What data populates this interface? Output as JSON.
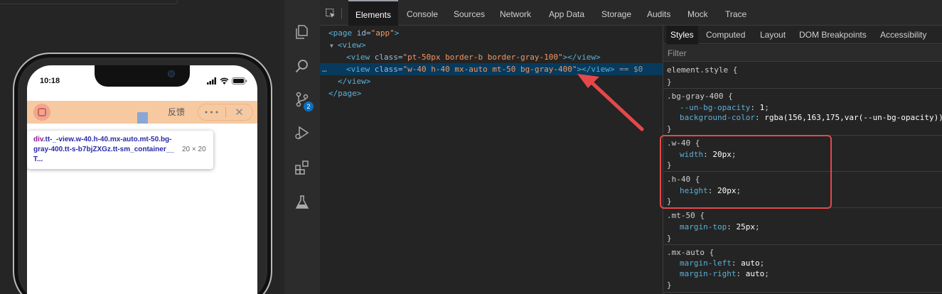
{
  "simulator": {
    "status_time": "10:18",
    "feedback_label": "反馈",
    "more_label": "•••",
    "close_label": "✕",
    "tooltip": {
      "tag": "div",
      "classes": ".tt-_-view.w-40.h-40.mx-auto.mt-50.bg-gray-400.tt-s-b7bjZXGz.tt-sm_container__T...",
      "size": "20 × 20"
    },
    "colors": {
      "navbar": "#f7c9a0",
      "element_highlight": "#8aa7d6"
    }
  },
  "activity_bar": {
    "icons": [
      "files-icon",
      "search-icon",
      "source-control-icon",
      "run-debug-icon",
      "extensions-icon",
      "test-flask-icon"
    ],
    "scm_badge": "2"
  },
  "devtools": {
    "tabs": [
      "Elements",
      "Console",
      "Sources",
      "Network",
      "App Data",
      "Storage",
      "Audits",
      "Mock",
      "Trace"
    ],
    "active_tab": "Elements",
    "dom": {
      "line1": {
        "open": "<page",
        "attr": " id=",
        "val": "\"app\"",
        "close": ">"
      },
      "line2": {
        "text": "<view>"
      },
      "line3": {
        "open": "<view",
        "attr": " class=",
        "val": "\"pt-50px border-b border-gray-100\"",
        "close": "></view>"
      },
      "line4": {
        "dots": "…",
        "open": "<view",
        "attr": " class=",
        "val": "\"w-40 h-40 mx-auto mt-50 bg-gray-400\"",
        "close": "></view>",
        "suffix": " == $0"
      },
      "line5": {
        "text": "</view>"
      },
      "line6": {
        "text": "</page>"
      }
    },
    "styles_tabs": [
      "Styles",
      "Computed",
      "Layout",
      "DOM Breakpoints",
      "Accessibility"
    ],
    "active_styles_tab": "Styles",
    "filter_placeholder": "Filter",
    "rules": {
      "element_style": {
        "selector": "element.style {",
        "close": "}"
      },
      "bg_gray_400": {
        "selector": ".bg-gray-400 {",
        "p1_name": "--un-bg-opacity",
        "p1_value": "1",
        "p2_name": "background-color",
        "p2_value": "rgba(156,163,175,var(--un-bg-opacity))",
        "close": "}"
      },
      "w_40": {
        "selector": ".w-40 {",
        "p1_name": "width",
        "p1_value": "20px",
        "close": "}"
      },
      "h_40": {
        "selector": ".h-40 {",
        "p1_name": "height",
        "p1_value": "20px",
        "close": "}"
      },
      "mt_50": {
        "selector": ".mt-50 {",
        "p1_name": "margin-top",
        "p1_value": "25px",
        "close": "}"
      },
      "mx_auto": {
        "selector": ".mx-auto {",
        "p1_name": "margin-left",
        "p1_value": "auto",
        "p2_name": "margin-right",
        "p2_value": "auto",
        "close": "}"
      }
    },
    "colors": {
      "annotation_red": "#e5484a",
      "selected_row": "#073a5c"
    }
  }
}
